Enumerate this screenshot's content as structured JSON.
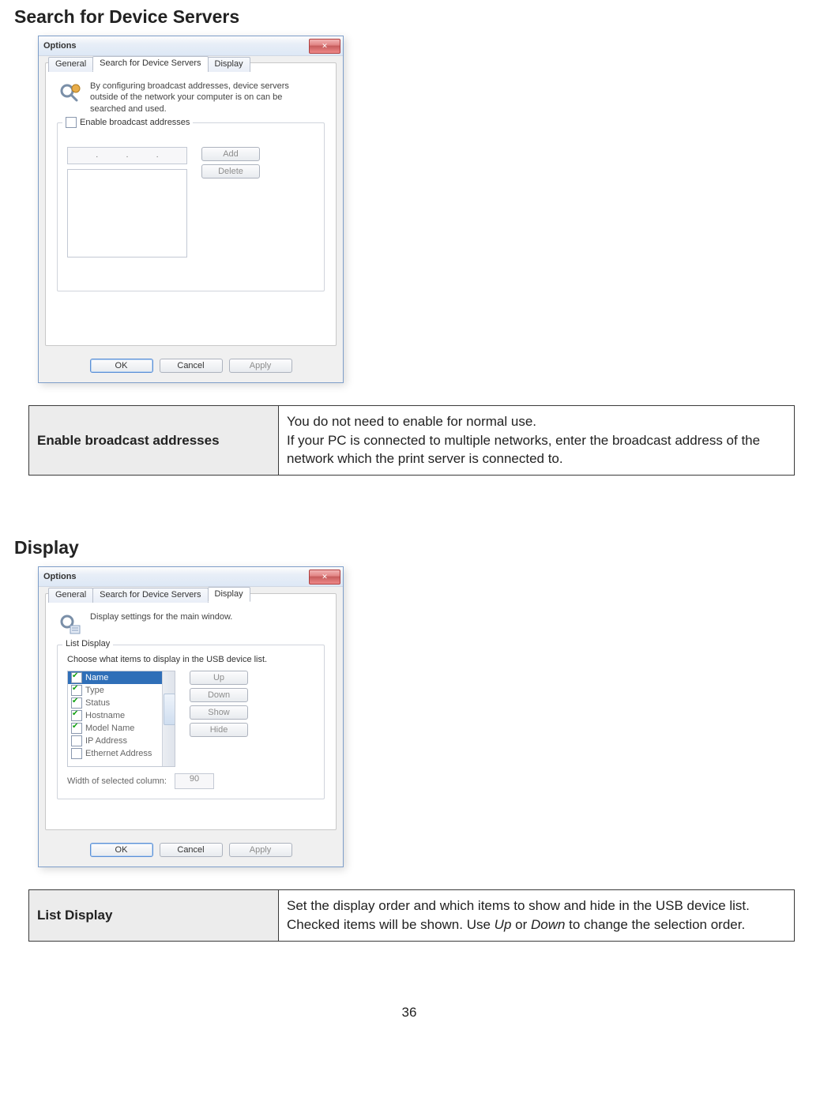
{
  "headings": {
    "search": "Search for Device Servers",
    "display": "Display"
  },
  "dialog1": {
    "title": "Options",
    "close": "✕",
    "tabs": {
      "general": "General",
      "search": "Search for Device Servers",
      "display": "Display"
    },
    "info": "By configuring broadcast addresses, device servers outside of the network your computer is on can be searched and used.",
    "group_label": "Enable broadcast addresses",
    "buttons": {
      "add": "Add",
      "delete": "Delete",
      "ok": "OK",
      "cancel": "Cancel",
      "apply": "Apply"
    },
    "ip_dots": [
      ".",
      ".",
      "."
    ]
  },
  "table1": {
    "left": "Enable broadcast addresses",
    "right_a": "You do not need to enable for normal use.",
    "right_b": "If your PC is connected to multiple networks, enter the broadcast address of the network which the print server is connected to."
  },
  "dialog2": {
    "title": "Options",
    "close": "✕",
    "tabs": {
      "general": "General",
      "search": "Search for Device Servers",
      "display": "Display"
    },
    "info": "Display settings for the main window.",
    "group_label": "List Display",
    "group_sub": "Choose what items to display in the USB device list.",
    "items": [
      {
        "label": "Name",
        "checked": true,
        "selected": true
      },
      {
        "label": "Type",
        "checked": true
      },
      {
        "label": "Status",
        "checked": true
      },
      {
        "label": "Hostname",
        "checked": true
      },
      {
        "label": "Model Name",
        "checked": true
      },
      {
        "label": "IP Address",
        "checked": false
      },
      {
        "label": "Ethernet Address",
        "checked": false
      }
    ],
    "buttons": {
      "up": "Up",
      "down": "Down",
      "show": "Show",
      "hide": "Hide",
      "ok": "OK",
      "cancel": "Cancel",
      "apply": "Apply"
    },
    "width_label": "Width of selected column:",
    "width_value": "90"
  },
  "table2": {
    "left": "List Display",
    "right_a": "Set the display order and which items to show and hide in the USB device list. Checked items will be shown. Use ",
    "right_up": "Up",
    "right_mid": " or ",
    "right_down": "Down",
    "right_b": " to change the selection order."
  },
  "page_number": "36"
}
